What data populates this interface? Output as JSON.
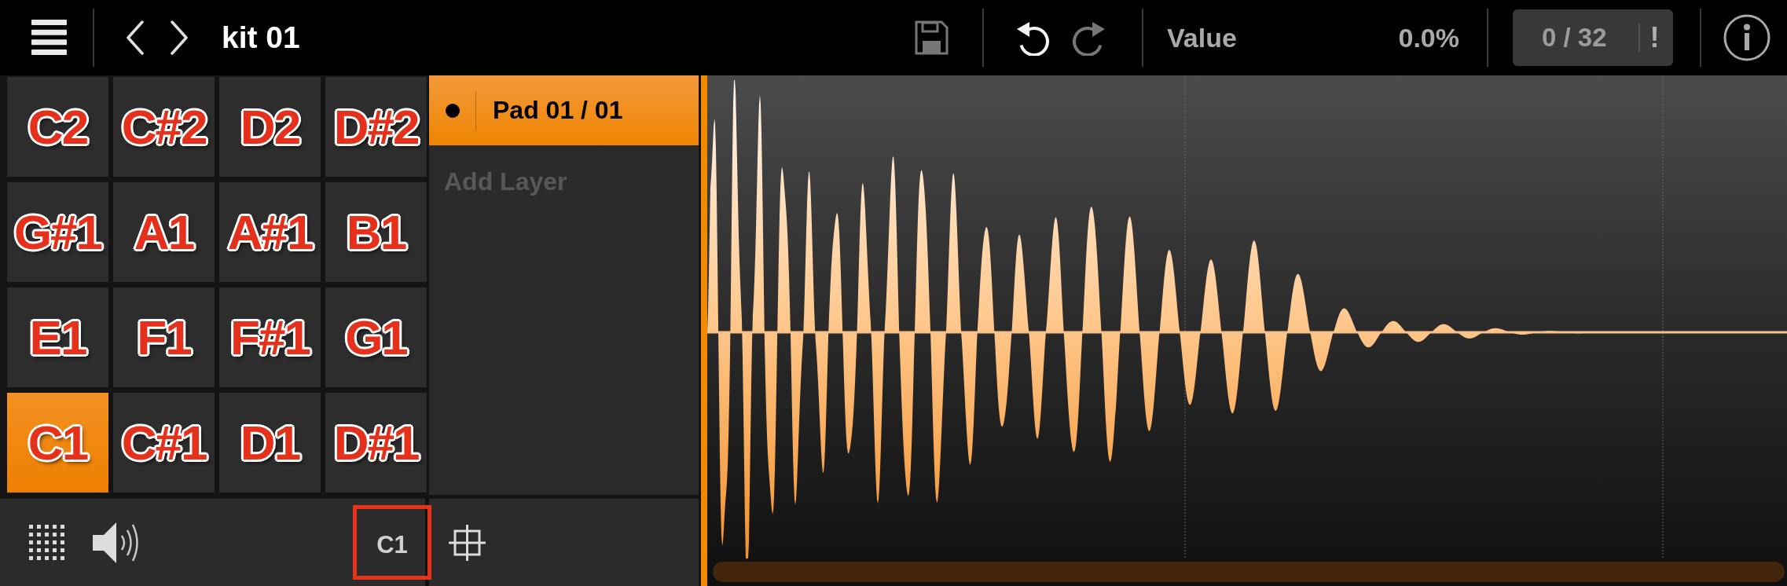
{
  "toolbar": {
    "title": "kit 01",
    "save": {
      "disabled": true
    },
    "undo": {
      "disabled": false
    },
    "redo": {
      "disabled": true
    },
    "value_label": "Value",
    "value_reading": "0.0%",
    "counter": "0 / 32",
    "alert": "!"
  },
  "pads": [
    {
      "label": "C2",
      "selected": false
    },
    {
      "label": "C#2",
      "selected": false
    },
    {
      "label": "D2",
      "selected": false
    },
    {
      "label": "D#2",
      "selected": false
    },
    {
      "label": "G#1",
      "selected": false
    },
    {
      "label": "A1",
      "selected": false
    },
    {
      "label": "A#1",
      "selected": false
    },
    {
      "label": "B1",
      "selected": false
    },
    {
      "label": "E1",
      "selected": false
    },
    {
      "label": "F1",
      "selected": false
    },
    {
      "label": "F#1",
      "selected": false
    },
    {
      "label": "G1",
      "selected": false
    },
    {
      "label": "C1",
      "selected": true
    },
    {
      "label": "C#1",
      "selected": false
    },
    {
      "label": "D1",
      "selected": false
    },
    {
      "label": "D#1",
      "selected": false
    }
  ],
  "layers": [
    {
      "label": "Pad 01 / 01",
      "selected": true
    }
  ],
  "add_layer": {
    "label": "Add Layer",
    "disabled": true
  },
  "bottom_bar": {
    "note": "C1",
    "highlighted": true
  }
}
